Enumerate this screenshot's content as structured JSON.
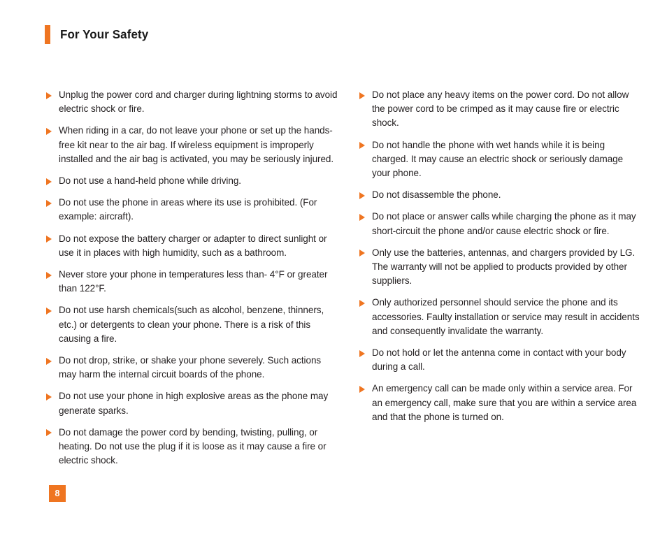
{
  "header": {
    "title": "For Your Safety",
    "accent_color": "#EF7521"
  },
  "bullet": {
    "icon": "triangle-right-icon",
    "color": "#EF7521"
  },
  "columns": {
    "left": [
      "Unplug the power cord and charger during lightning storms to avoid electric shock or fire.",
      "When riding in a car, do not leave your phone or set up the hands-free kit near to the air bag. If wireless equipment is improperly installed and the air bag is activated, you may be seriously injured.",
      "Do not use a hand-held phone while driving.",
      "Do not use the phone in areas where its use is prohibited. (For example: aircraft).",
      "Do not expose the battery charger or adapter to direct sunlight or use it in places with high humidity, such as a bathroom.",
      "Never store your phone in temperatures less than- 4°F or greater than 122°F.",
      "Do not use harsh chemicals(such as alcohol, benzene, thinners, etc.) or detergents to clean your phone. There is a risk of this causing a fire.",
      "Do not drop, strike, or shake your phone severely. Such actions may harm the internal circuit boards of the phone.",
      "Do not use your phone in high explosive areas as the phone may generate sparks.",
      "Do not damage the power cord by bending, twisting, pulling, or heating. Do not use the plug if it is loose as it may cause a fire or electric shock."
    ],
    "right": [
      "Do not place any heavy items on the power cord. Do not allow the power cord to be crimped as it may cause fire or electric shock.",
      "Do not handle the phone with wet hands while it is being charged. It may cause an electric shock or seriously damage your phone.",
      "Do not disassemble the phone.",
      "Do not place or answer calls while charging the phone as it may short-circuit the phone and/or cause electric shock or fire.",
      "Only use the batteries, antennas, and chargers provided by LG. The warranty will not be applied to products provided by other suppliers.",
      "Only authorized personnel should service the phone and its accessories. Faulty installation or service may result in accidents and consequently invalidate the warranty.",
      "Do not hold or let the antenna come in contact with your body during a call.",
      "An emergency call can be made only within a service area. For an emergency call, make sure that you are within a service area and that the phone is turned on."
    ]
  },
  "footer": {
    "page_number": "8",
    "badge_color": "#EF7521"
  }
}
